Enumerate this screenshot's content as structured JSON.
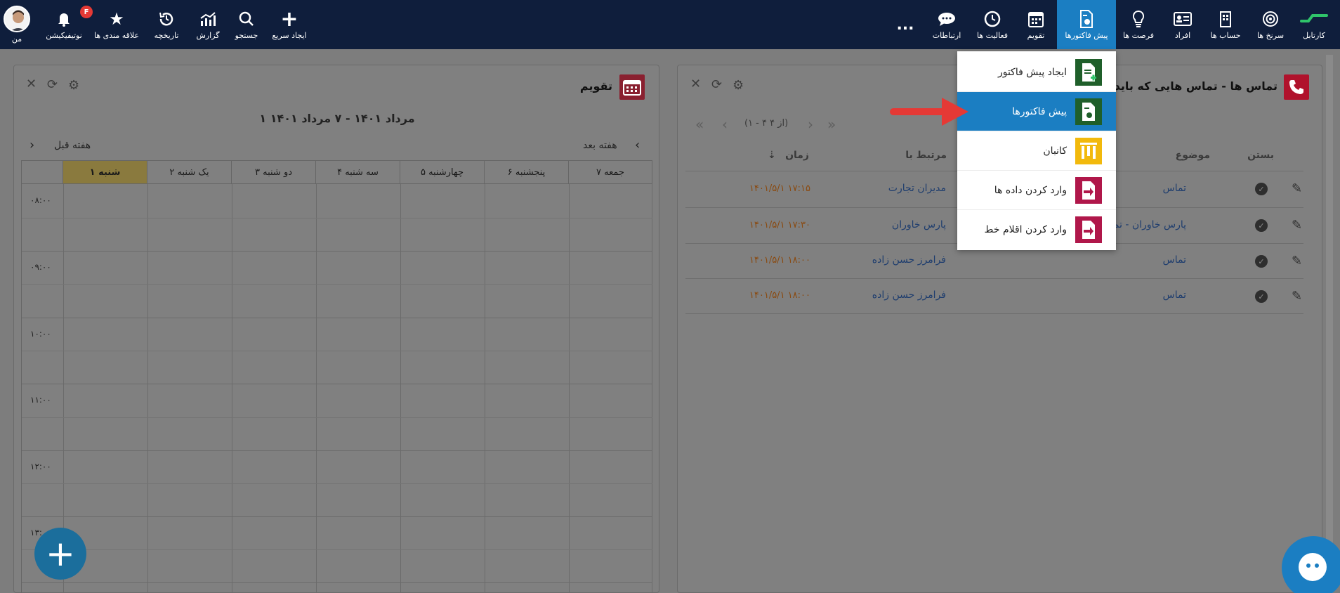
{
  "nav": {
    "items": [
      {
        "label": "کارتابل",
        "icon": "cartable-logo-icon"
      },
      {
        "label": "سرنخ ها",
        "icon": "target-icon"
      },
      {
        "label": "حساب ها",
        "icon": "building-icon"
      },
      {
        "label": "افراد",
        "icon": "contact-card-icon"
      },
      {
        "label": "فرصت ها",
        "icon": "lightbulb-icon"
      },
      {
        "label": "پیش فاکتورها",
        "icon": "invoice-icon",
        "active": true
      },
      {
        "label": "تقویم",
        "icon": "calendar-icon"
      },
      {
        "label": "فعالیت ها",
        "icon": "clock-icon"
      },
      {
        "label": "ارتباطات",
        "icon": "chat-icon"
      }
    ],
    "more": "...",
    "left_items": [
      {
        "label": "ایجاد سریع",
        "icon": "plus-icon"
      },
      {
        "label": "جستجو",
        "icon": "search-icon"
      },
      {
        "label": "گزارش",
        "icon": "chart-icon"
      },
      {
        "label": "تاریخچه",
        "icon": "history-icon"
      },
      {
        "label": "علاقه مندی ها",
        "icon": "star-icon"
      },
      {
        "label": "نوتیفیکیشن",
        "icon": "bell-icon",
        "badge": "F"
      },
      {
        "label": "من",
        "icon": "avatar"
      }
    ]
  },
  "calendar_panel": {
    "title": "تقویم",
    "range": "۱ مرداد ۱۴۰۱ - ۷ مرداد ۱۴۰۱",
    "next_week": "هفته بعد",
    "prev_week": "هفته قبل",
    "days": [
      "جمعه ۷",
      "پنجشنبه ۶",
      "چهارشنبه ۵",
      "سه شنبه ۴",
      "دو شنبه ۳",
      "یک شنبه ۲",
      "شنبه ۱"
    ],
    "times": [
      "۰۸:۰۰",
      "۰۹:۰۰",
      "۱۰:۰۰",
      "۱۱:۰۰",
      "۱۲:۰۰",
      "۱۳:"
    ]
  },
  "calls_panel": {
    "title": "تماس ها - تماس هایی که باید بگ",
    "pager": "(۱ - ۴ از ۴)",
    "columns": {
      "close": "بستن",
      "subject": "موضوع",
      "related": "مرتبط با",
      "time": "زمان"
    },
    "rows": [
      {
        "subject": "تماس",
        "related": "مدیران تجارت",
        "time": "۱۴۰۱/۵/۱ ۱۷:۱۵"
      },
      {
        "subject": "پارس خاوران - تماس پ",
        "related": "پارس خاوران",
        "time": "۱۴۰۱/۵/۱ ۱۷:۳۰"
      },
      {
        "subject": "تماس",
        "related": "فرامرز حسن زاده",
        "time": "۱۴۰۱/۵/۱ ۱۸:۰۰"
      },
      {
        "subject": "تماس",
        "related": "فرامرز حسن زاده",
        "time": "۱۴۰۱/۵/۱ ۱۸:۰۰"
      }
    ]
  },
  "dropdown": {
    "items": [
      {
        "label": "ایجاد پیش فاکتور",
        "icon": "create-invoice-icon",
        "color": "#1f5f2a"
      },
      {
        "label": "پیش فاکتورها",
        "icon": "invoice-list-icon",
        "color": "#1f5f2a",
        "active": true
      },
      {
        "label": "کانبان",
        "icon": "kanban-icon",
        "color": "#f2b90c"
      },
      {
        "label": "وارد کردن داده ها",
        "icon": "import-data-icon",
        "color": "#b0174a"
      },
      {
        "label": "وارد کردن اقلام خط",
        "icon": "import-lines-icon",
        "color": "#b0174a"
      }
    ]
  },
  "colors": {
    "nav_bg": "#0f1e3c",
    "active": "#1b7ec2",
    "overlay": "#7d7d7d",
    "arrow": "#e53935"
  }
}
